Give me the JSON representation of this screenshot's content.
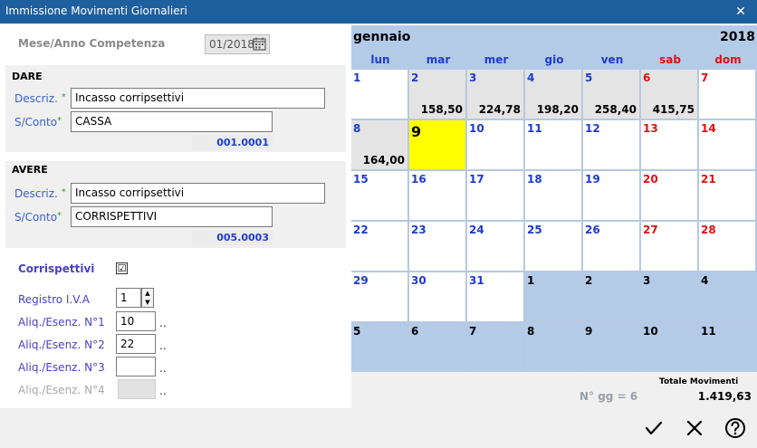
{
  "window": {
    "title": "Immissione Movimenti Giornalieri"
  },
  "competenza": {
    "label": "Mese/Anno Competenza",
    "value": "01/2018"
  },
  "dare": {
    "header": "DARE",
    "descr_label": "Descriz.",
    "descr_value": "Incasso corripsettivi",
    "conto_label": "S/Conto",
    "conto_value": "CASSA",
    "code": "001.0001"
  },
  "avere": {
    "header": "AVERE",
    "descr_label": "Descriz.",
    "descr_value": "Incasso corripsettivi",
    "conto_label": "S/Conto",
    "conto_value": "CORRISPETTIVI",
    "code": "005.0003"
  },
  "star": "*",
  "corrispettivi": {
    "label": "Corrispettivi",
    "checked": true,
    "check_mark": "☑"
  },
  "iva": {
    "registro_label": "Registro I.V.A",
    "registro_value": "1",
    "aliq1_label": "Aliq./Esenz. N°1",
    "aliq1_value": "10",
    "aliq2_label": "Aliq./Esenz. N°2",
    "aliq2_value": "22",
    "aliq3_label": "Aliq./Esenz. N°3",
    "aliq3_value": "",
    "aliq4_label": "Aliq./Esenz. N°4",
    "dots": ".."
  },
  "calendar": {
    "month": "gennaio",
    "year": "2018",
    "weekdays": [
      "lun",
      "mar",
      "mer",
      "gio",
      "ven",
      "sab",
      "dom"
    ],
    "weekday_colors": [
      "#1d3bd1",
      "#1d3bd1",
      "#1d3bd1",
      "#1d3bd1",
      "#1d3bd1",
      "#e01010",
      "#e01010"
    ],
    "weeks": [
      [
        {
          "d": "1",
          "bg": "w",
          "c": "b",
          "a": ""
        },
        {
          "d": "2",
          "bg": "g",
          "c": "b",
          "a": "158,50"
        },
        {
          "d": "3",
          "bg": "g",
          "c": "b",
          "a": "224,78"
        },
        {
          "d": "4",
          "bg": "g",
          "c": "b",
          "a": "198,20"
        },
        {
          "d": "5",
          "bg": "g",
          "c": "b",
          "a": "258,40"
        },
        {
          "d": "6",
          "bg": "g",
          "c": "r",
          "a": "415,75"
        },
        {
          "d": "7",
          "bg": "w",
          "c": "r",
          "a": ""
        }
      ],
      [
        {
          "d": "8",
          "bg": "g",
          "c": "b",
          "a": "164,00"
        },
        {
          "d": "9",
          "bg": "y",
          "c": "k",
          "a": ""
        },
        {
          "d": "10",
          "bg": "w",
          "c": "b",
          "a": ""
        },
        {
          "d": "11",
          "bg": "w",
          "c": "b",
          "a": ""
        },
        {
          "d": "12",
          "bg": "w",
          "c": "b",
          "a": ""
        },
        {
          "d": "13",
          "bg": "w",
          "c": "r",
          "a": ""
        },
        {
          "d": "14",
          "bg": "w",
          "c": "r",
          "a": ""
        }
      ],
      [
        {
          "d": "15",
          "bg": "w",
          "c": "b",
          "a": ""
        },
        {
          "d": "16",
          "bg": "w",
          "c": "b",
          "a": ""
        },
        {
          "d": "17",
          "bg": "w",
          "c": "b",
          "a": ""
        },
        {
          "d": "18",
          "bg": "w",
          "c": "b",
          "a": ""
        },
        {
          "d": "19",
          "bg": "w",
          "c": "b",
          "a": ""
        },
        {
          "d": "20",
          "bg": "w",
          "c": "r",
          "a": ""
        },
        {
          "d": "21",
          "bg": "w",
          "c": "r",
          "a": ""
        }
      ],
      [
        {
          "d": "22",
          "bg": "w",
          "c": "b",
          "a": ""
        },
        {
          "d": "23",
          "bg": "w",
          "c": "b",
          "a": ""
        },
        {
          "d": "24",
          "bg": "w",
          "c": "b",
          "a": ""
        },
        {
          "d": "25",
          "bg": "w",
          "c": "b",
          "a": ""
        },
        {
          "d": "26",
          "bg": "w",
          "c": "b",
          "a": ""
        },
        {
          "d": "27",
          "bg": "w",
          "c": "r",
          "a": ""
        },
        {
          "d": "28",
          "bg": "w",
          "c": "r",
          "a": ""
        }
      ],
      [
        {
          "d": "29",
          "bg": "w",
          "c": "b",
          "a": ""
        },
        {
          "d": "30",
          "bg": "w",
          "c": "b",
          "a": ""
        },
        {
          "d": "31",
          "bg": "w",
          "c": "b",
          "a": ""
        },
        {
          "d": "1",
          "bg": "o",
          "c": "k",
          "a": ""
        },
        {
          "d": "2",
          "bg": "o",
          "c": "k",
          "a": ""
        },
        {
          "d": "3",
          "bg": "o",
          "c": "k",
          "a": ""
        },
        {
          "d": "4",
          "bg": "o",
          "c": "k",
          "a": ""
        }
      ],
      [
        {
          "d": "5",
          "bg": "o",
          "c": "k",
          "a": ""
        },
        {
          "d": "6",
          "bg": "o",
          "c": "k",
          "a": ""
        },
        {
          "d": "7",
          "bg": "o",
          "c": "k",
          "a": ""
        },
        {
          "d": "8",
          "bg": "o",
          "c": "k",
          "a": ""
        },
        {
          "d": "9",
          "bg": "o",
          "c": "k",
          "a": ""
        },
        {
          "d": "10",
          "bg": "o",
          "c": "k",
          "a": ""
        },
        {
          "d": "11",
          "bg": "o",
          "c": "k",
          "a": ""
        }
      ]
    ]
  },
  "summary": {
    "ngg": "N° gg = 6",
    "totale_label": "Totale Movimenti",
    "totale_value": "1.419,63"
  },
  "colors": {
    "title_bar": "#1e5f9e",
    "calendar_bg": "#b4cbe8",
    "today": "#ffff00",
    "weekday": "#1d3bd1",
    "weekend": "#e01010"
  },
  "icons": {
    "confirm": "check-icon",
    "cancel": "x-icon",
    "help": "help-icon",
    "close": "close-icon",
    "calendar": "calendar-icon"
  }
}
